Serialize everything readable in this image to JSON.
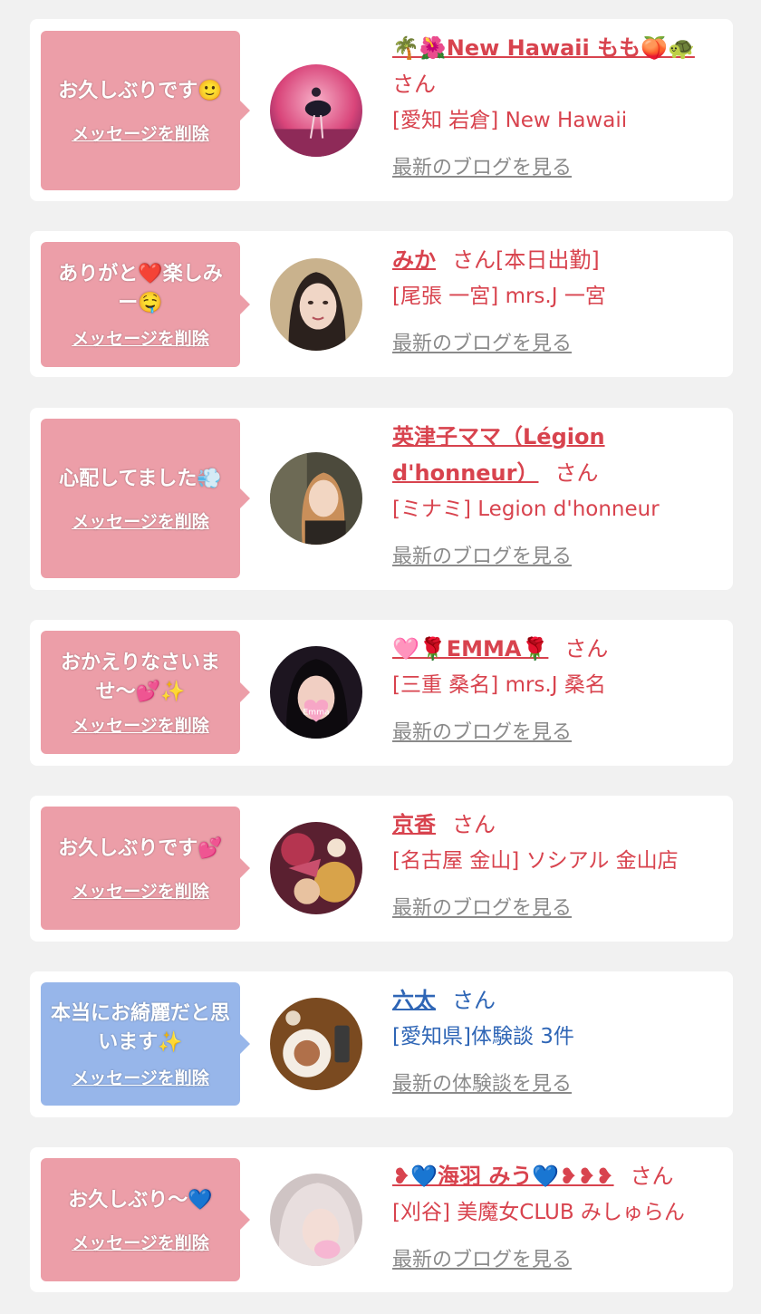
{
  "colors": {
    "bubble_pink": "#ec9ea8",
    "bubble_blue": "#97b6ea",
    "name_red": "#d8434e",
    "name_blue": "#2f66b6",
    "link_gray": "#8a8a8a"
  },
  "delete_label": "メッセージを削除",
  "cards": [
    {
      "message": "お久しぶりです🙂",
      "name": "🌴🌺New Hawaii もも🍑🐢",
      "san": "さん",
      "location": "[愛知 岩倉] New Hawaii",
      "blog": "最新のブログを見る",
      "bubble": "pink",
      "avatar_icon": "dancer-photo-avatar"
    },
    {
      "message": "ありがと❤️楽しみー🤤",
      "name": "みか",
      "san": "さん[本日出勤]",
      "location": "[尾張 一宮] mrs.J 一宮",
      "blog": "最新のブログを見る",
      "bubble": "pink",
      "avatar_icon": "woman-portrait-avatar"
    },
    {
      "message": "心配してました💨",
      "name": "英津子ママ（Légion d'honneur）",
      "san": "さん",
      "location": "[ミナミ] Legion d'honneur",
      "blog": "最新のブログを見る",
      "bubble": "pink",
      "avatar_icon": "woman-smiling-avatar"
    },
    {
      "message": "おかえりなさいませ〜💕✨",
      "name": "🩷🌹EMMA🌹",
      "san": "さん",
      "location": "[三重 桑名] mrs.J 桑名",
      "blog": "最新のブログを見る",
      "bubble": "pink",
      "avatar_icon": "woman-heart-sticker-avatar"
    },
    {
      "message": "お久しぶりです💕",
      "name": "京香",
      "san": "さん",
      "location": "[名古屋 金山] ソシアル 金山店",
      "blog": "最新のブログを見る",
      "bubble": "pink",
      "avatar_icon": "kimono-photo-avatar"
    },
    {
      "message": "本当にお綺麗だと思います✨",
      "name": "六太",
      "san": "さん",
      "location": "[愛知県]体験談 3件",
      "blog": "最新の体験談を見る",
      "bubble": "blue",
      "avatar_icon": "dinner-plate-avatar"
    },
    {
      "message": "お久しぶり〜💙",
      "name": "❥💙海羽 みう💙❥❥❥",
      "san": "さん",
      "location": "[刈谷] 美魔女CLUB みしゅらん",
      "blog": "最新のブログを見る",
      "bubble": "pink",
      "avatar_icon": "blonde-woman-avatar"
    }
  ]
}
